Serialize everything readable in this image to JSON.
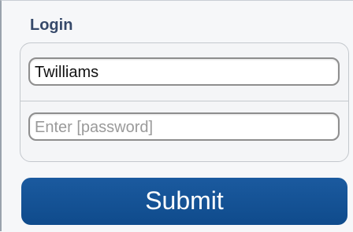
{
  "login": {
    "title": "Login",
    "username_value": "Twilliams",
    "password_placeholder": "Enter [password]",
    "submit_label": "Submit"
  },
  "colors": {
    "title": "#36496a",
    "submit_bg": "#1b5a9f",
    "field_border": "#8e8e8e",
    "background": "#f6f7f9"
  }
}
